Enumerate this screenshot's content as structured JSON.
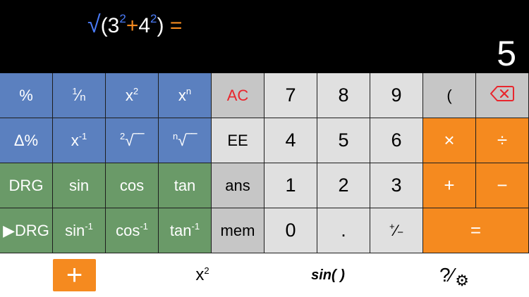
{
  "display": {
    "expression": {
      "sqrt": "√",
      "open": "(",
      "base1": "3",
      "exp1": "2",
      "op": "+",
      "base2": "4",
      "exp2": "2",
      "close": ")",
      "equals": "="
    },
    "result": "5"
  },
  "keys": {
    "percent": "%",
    "reciprocal_num": "1",
    "reciprocal_sep": "⁄",
    "reciprocal_den": "n",
    "square_base": "x",
    "square_exp": "2",
    "power_base": "x",
    "power_exp": "n",
    "clear": "AC",
    "seven": "7",
    "eight": "8",
    "nine": "9",
    "paren": "(",
    "delta_percent": "Δ%",
    "inverse_base": "x",
    "inverse_exp": "-1",
    "sqrt2_index": "2",
    "sqrt2_sign": "√‾‾",
    "sqrtn_index": "n",
    "sqrtn_sign": "√‾‾",
    "ee": "EE",
    "four": "4",
    "five": "5",
    "six": "6",
    "multiply": "×",
    "divide": "÷",
    "drg": "DRG",
    "sin": "sin",
    "cos": "cos",
    "tan": "tan",
    "ans": "ans",
    "one": "1",
    "two": "2",
    "three": "3",
    "plus": "+",
    "minus": "−",
    "drg_convert": "▶DRG",
    "asin_base": "sin",
    "asin_exp": "-1",
    "acos_base": "cos",
    "acos_exp": "-1",
    "atan_base": "tan",
    "atan_exp": "-1",
    "mem": "mem",
    "zero": "0",
    "decimal": ".",
    "negate_plus": "+",
    "negate_sep": "⁄",
    "negate_minus": "−",
    "equals": "="
  },
  "toolbar": {
    "plus": "+",
    "x2_base": "x",
    "x2_exp": "2",
    "sin": "sin( )",
    "help": "?⁄",
    "gear": "⚙"
  },
  "icons": {
    "backspace": "backspace-icon",
    "gear": "gear-icon"
  },
  "colors": {
    "blue_key": "#5b80bf",
    "green_key": "#6a9a68",
    "orange_key": "#f58a1f",
    "gray_key": "#c6c6c6",
    "light_key": "#e0e0e0",
    "clear_text": "#e8262d",
    "expression_blue": "#4a7bf7",
    "expression_orange": "#f58a1f"
  }
}
